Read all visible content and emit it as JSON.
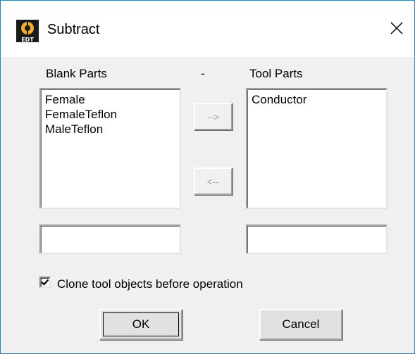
{
  "window": {
    "title": "Subtract",
    "close_icon": "close-icon",
    "app_icon": "edt-app-icon"
  },
  "blank_parts": {
    "label": "Blank Parts",
    "items": [
      "Female",
      "FemaleTeflon",
      "MaleTeflon"
    ],
    "input_value": ""
  },
  "separator": "-",
  "tool_parts": {
    "label": "Tool Parts",
    "items": [
      "Conductor"
    ],
    "input_value": ""
  },
  "move_right_label": "-->",
  "move_left_label": "<--",
  "clone_option": {
    "label": "Clone tool objects before operation",
    "checked": true
  },
  "buttons": {
    "ok": "OK",
    "cancel": "Cancel"
  },
  "colors": {
    "title_bar": "#ffffff",
    "border": "#3c7fb1",
    "dialog_bg": "#f0f0f0",
    "disabled_text": "#a0a0a0"
  }
}
